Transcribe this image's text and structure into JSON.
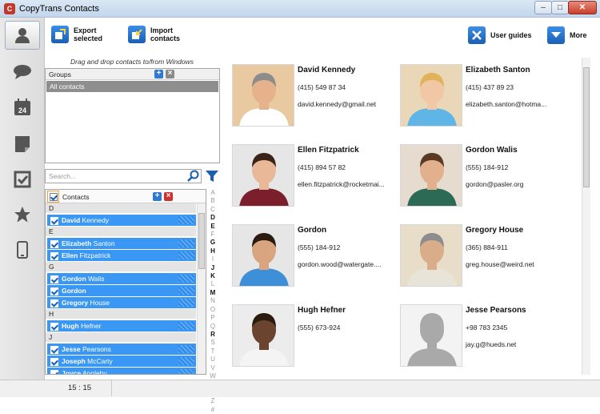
{
  "window": {
    "title": "CopyTrans Contacts",
    "min": "–",
    "max": "□",
    "close": "✕"
  },
  "toolbar": {
    "export_label": "Export selected",
    "import_label": "Import contacts",
    "guides_label": "User guides",
    "more_label": "More"
  },
  "groups_panel": {
    "hint": "Drag and drop contacts to/from Windows",
    "header": "Groups",
    "selected": "All contacts"
  },
  "search": {
    "placeholder": "Search..."
  },
  "contacts_panel": {
    "header": "Contacts"
  },
  "contact_list": [
    {
      "letter": "D",
      "rows": [
        {
          "first": "David",
          "last": " Kennedy"
        }
      ]
    },
    {
      "letter": "E",
      "rows": [
        {
          "first": "Elizabeth",
          "last": " Santon"
        },
        {
          "first": "Ellen",
          "last": " Fitzpatrick"
        }
      ]
    },
    {
      "letter": "G",
      "rows": [
        {
          "first": "Gordon",
          "last": " Walis"
        },
        {
          "first": "Gordon",
          "last": ""
        },
        {
          "first": "Gregory",
          "last": " House"
        }
      ]
    },
    {
      "letter": "H",
      "rows": [
        {
          "first": "Hugh",
          "last": " Hefner"
        }
      ]
    },
    {
      "letter": "J",
      "rows": [
        {
          "first": "Jesse",
          "last": " Pearsons"
        },
        {
          "first": "Joseph",
          "last": " McCarty"
        },
        {
          "first": "Joyce",
          "last": " Appleby"
        }
      ]
    }
  ],
  "alphabet": [
    "A",
    "B",
    "C",
    "D",
    "E",
    "F",
    "G",
    "H",
    "I",
    "J",
    "K",
    "L",
    "M",
    "N",
    "O",
    "P",
    "Q",
    "R",
    "S",
    "T",
    "U",
    "V",
    "W",
    "X",
    "Y",
    "Z",
    "#"
  ],
  "alphabet_bold": [
    "D",
    "E",
    "G",
    "H",
    "J",
    "K",
    "M",
    "R"
  ],
  "cards": [
    {
      "name": "David Kennedy",
      "phone": "(415) 549 87 34",
      "email": "david.kennedy@gmail.net"
    },
    {
      "name": "Elizabeth Santon",
      "phone": "(415) 437 89 23",
      "email": "elizabeth.santon@hotma..."
    },
    {
      "name": "Ellen Fitzpatrick",
      "phone": "(415) 894 57 82",
      "email": "ellen.fitzpatrick@rocketmai..."
    },
    {
      "name": "Gordon Walis",
      "phone": "(555) 184-912",
      "email": "gordon@pasler.org"
    },
    {
      "name": "Gordon",
      "phone": "(555) 184-912",
      "email": "gordon.wood@watergate...."
    },
    {
      "name": "Gregory House",
      "phone": "(365) 884-911",
      "email": "greg.house@weird.net"
    },
    {
      "name": "Hugh Hefner",
      "phone": "(555) 673-924",
      "email": ""
    },
    {
      "name": "Jesse Pearsons",
      "phone": "+98 783 2345",
      "email": "jay.g@hueds.net"
    }
  ],
  "status": {
    "time": "15 : 15"
  },
  "colors": {
    "accent": "#3a97f3",
    "title_bar": "#c3d6ec",
    "selected_group": "#8e8e8e"
  }
}
